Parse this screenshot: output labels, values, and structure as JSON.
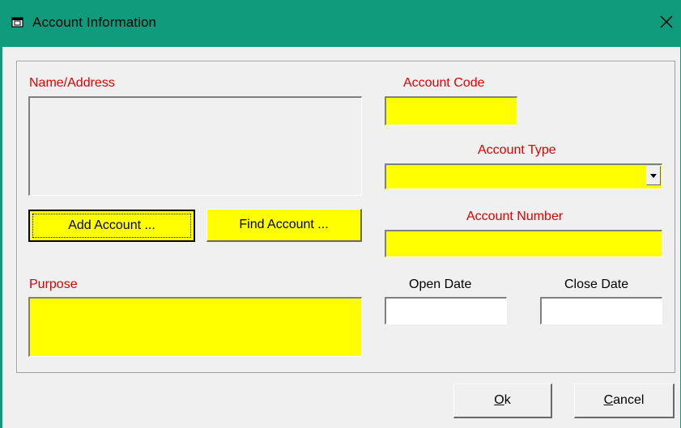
{
  "window": {
    "title": "Account Information",
    "title_bar_color": "#109c7c",
    "close_icon": "close-icon"
  },
  "form": {
    "name_address_label": "Name/Address",
    "name_address_value": "",
    "account_code_label": "Account Code",
    "account_code_value": "",
    "account_type_label": "Account Type",
    "account_type_value": "",
    "account_number_label": "Account Number",
    "account_number_value": "",
    "purpose_label": "Purpose",
    "purpose_value": "",
    "open_date_label": "Open Date",
    "open_date_value": "",
    "close_date_label": "Close Date",
    "close_date_value": "",
    "required_label_color": "#e00000",
    "required_field_color": "#ffff00"
  },
  "buttons": {
    "add_account": "Add Account ...",
    "find_account": "Find Account ...",
    "ok_accel": "O",
    "ok_rest": "k",
    "cancel_accel": "C",
    "cancel_rest": "ancel"
  }
}
